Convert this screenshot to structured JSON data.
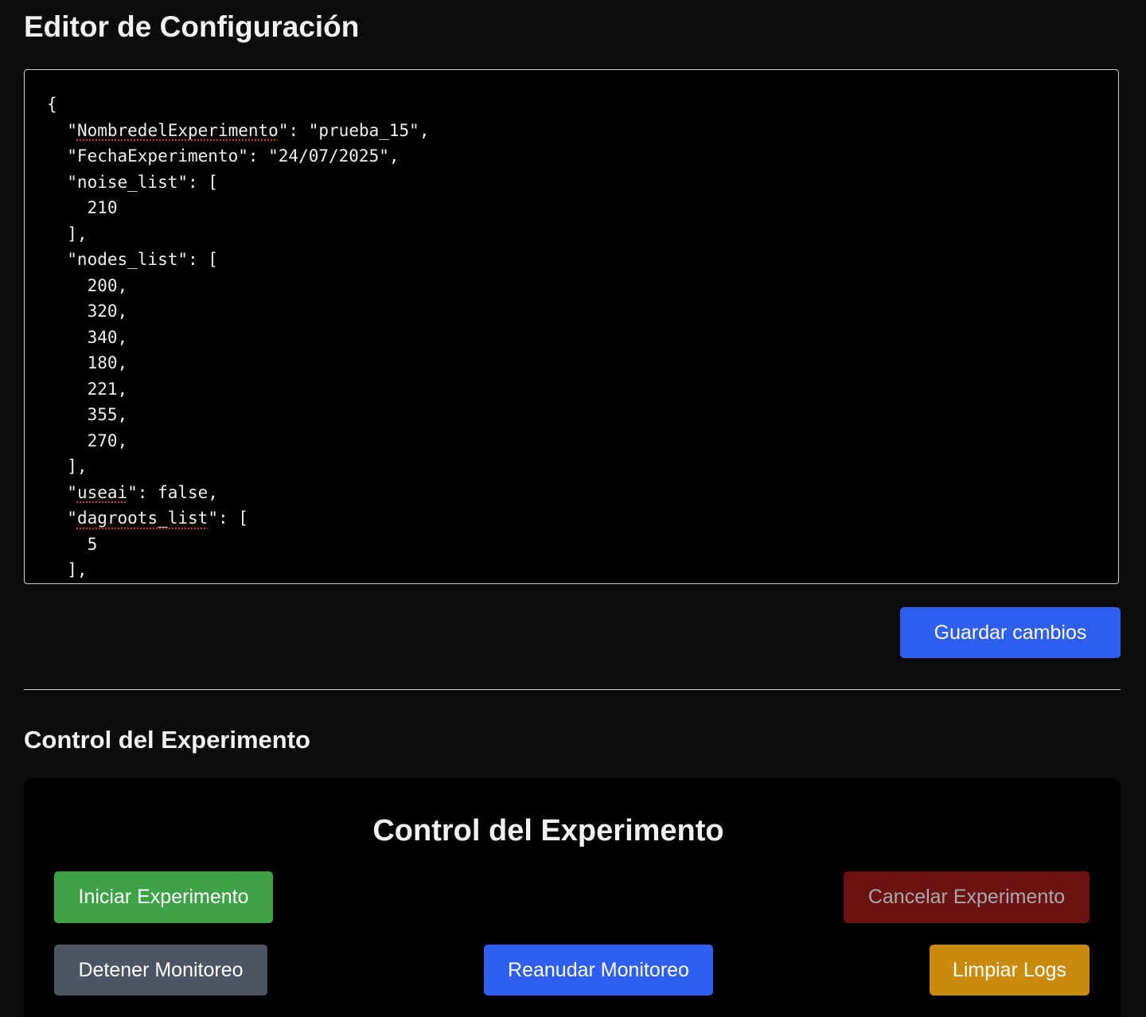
{
  "editor": {
    "title": "Editor de Configuración",
    "lines": [
      {
        "pre": "{",
        "spell": "",
        "post": ""
      },
      {
        "pre": "  \"",
        "spell": "NombredelExperimento",
        "post": "\": \"prueba_15\","
      },
      {
        "pre": "  \"FechaExperimento\": \"24/07/2025\",",
        "spell": "",
        "post": ""
      },
      {
        "pre": "  \"noise_list\": [",
        "spell": "",
        "post": ""
      },
      {
        "pre": "    210",
        "spell": "",
        "post": ""
      },
      {
        "pre": "  ],",
        "spell": "",
        "post": ""
      },
      {
        "pre": "  \"nodes_list\": [",
        "spell": "",
        "post": ""
      },
      {
        "pre": "    200,",
        "spell": "",
        "post": ""
      },
      {
        "pre": "    320,",
        "spell": "",
        "post": ""
      },
      {
        "pre": "    340,",
        "spell": "",
        "post": ""
      },
      {
        "pre": "    180,",
        "spell": "",
        "post": ""
      },
      {
        "pre": "    221,",
        "spell": "",
        "post": ""
      },
      {
        "pre": "    355,",
        "spell": "",
        "post": ""
      },
      {
        "pre": "    270,",
        "spell": "",
        "post": ""
      },
      {
        "pre": "  ],",
        "spell": "",
        "post": ""
      },
      {
        "pre": "  \"",
        "spell": "useai",
        "post": "\": false,"
      },
      {
        "pre": "  \"",
        "spell": "dagroots_list",
        "post": "\": ["
      },
      {
        "pre": "    5",
        "spell": "",
        "post": ""
      },
      {
        "pre": "  ],",
        "spell": "",
        "post": ""
      }
    ],
    "save_label": "Guardar cambios"
  },
  "control": {
    "section_title": "Control del Experimento",
    "panel_title": "Control del Experimento",
    "start_label": "Iniciar Experimento",
    "cancel_label": "Cancelar Experimento",
    "stop_label": "Detener Monitoreo",
    "resume_label": "Reanudar Monitoreo",
    "clear_label": "Limpiar Logs"
  },
  "colors": {
    "background": "#0b0b0b",
    "primary_blue": "#2f5ff0",
    "success_green": "#3ea347",
    "danger_disabled": "#6b1212",
    "neutral_gray": "#4b5563",
    "warning_amber": "#ca8a0c"
  }
}
